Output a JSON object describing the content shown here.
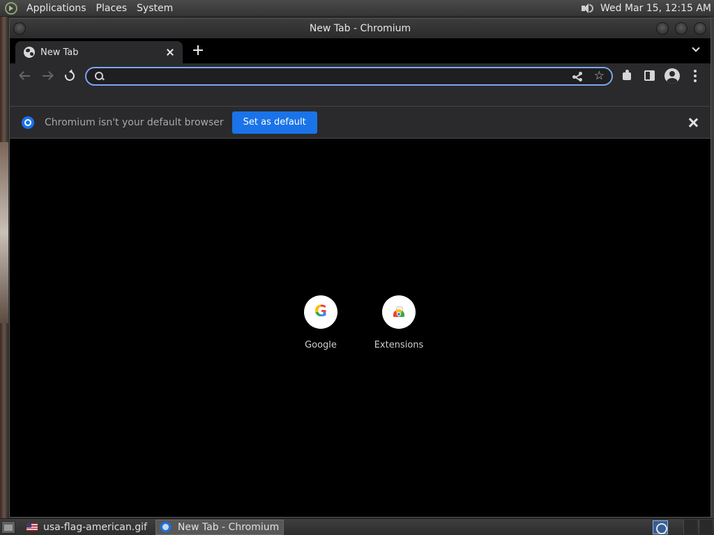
{
  "top_panel": {
    "menus": [
      "Applications",
      "Places",
      "System"
    ],
    "clock": "Wed Mar 15, 12:15 AM"
  },
  "window": {
    "title": "New Tab - Chromium"
  },
  "tabs": [
    {
      "title": "New Tab",
      "active": true
    }
  ],
  "omnibox": {
    "value": "",
    "placeholder": ""
  },
  "infobar": {
    "message": "Chromium isn't your default browser",
    "button_label": "Set as default"
  },
  "shortcuts": [
    {
      "label": "Google",
      "icon": "google-g-icon"
    },
    {
      "label": "Extensions",
      "icon": "chrome-web-store-icon"
    }
  ],
  "taskbar": {
    "tasks": [
      {
        "label": "usa-flag-american.gif",
        "icon": "usa-flag-icon",
        "active": false
      },
      {
        "label": "New Tab - Chromium",
        "icon": "chromium-icon",
        "active": true
      }
    ]
  },
  "colors": {
    "accent": "#1a73e8",
    "omnibox_focus": "#7ba7f0",
    "toolbar_bg": "#2a2a2c",
    "page_bg": "#000000"
  }
}
